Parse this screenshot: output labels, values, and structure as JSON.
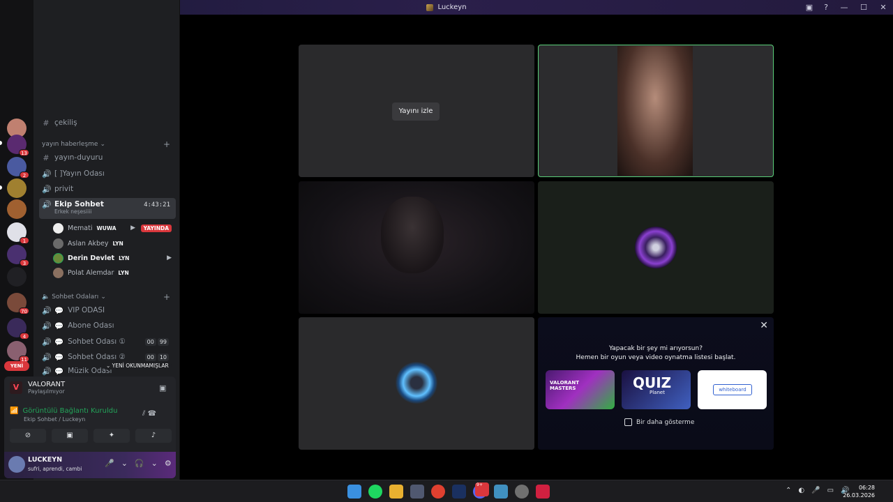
{
  "window": {
    "title": "Luckeyn",
    "controls": [
      "minimize",
      "maximize",
      "close"
    ]
  },
  "server_badges": [
    "13",
    "2",
    "1",
    "3",
    "70",
    "4",
    "11"
  ],
  "new_badge": "YENİ",
  "channels": {
    "partial_top": "çekiliş",
    "category1": {
      "label": "yayın haberleşme"
    },
    "items1": [
      {
        "icon": "#",
        "label": "yayın-duyuru"
      },
      {
        "icon": "speaker",
        "label": "[  ]Yayın Odası"
      },
      {
        "icon": "speaker",
        "label": "privit"
      }
    ],
    "active": {
      "label": "Ekip Sohbet",
      "status": "Erkek neşesiiii",
      "time": "4:43:21"
    },
    "members": [
      {
        "name": "Memati",
        "tag": "WUWA",
        "live": "YAYINDA"
      },
      {
        "name": "Aslan Akbey",
        "tag": "LYN"
      },
      {
        "name": "Derin Devlet",
        "tag": "LYN"
      },
      {
        "name": "Polat Alemdar",
        "tag": "LYN"
      }
    ],
    "category2": {
      "label": "Sohbet Odaları"
    },
    "items2": [
      {
        "label": "VIP ODASI"
      },
      {
        "label": "Abone Odası"
      },
      {
        "label": "Sohbet Odası ①",
        "counts": [
          "00",
          "99"
        ]
      },
      {
        "label": "Sohbet Odası ②",
        "counts": [
          "00",
          "10"
        ]
      },
      {
        "label": "Müzik Odası"
      }
    ],
    "unread_label": "YENİ OKUNMAMIŞLAR"
  },
  "panel": {
    "game_name": "VALORANT",
    "game_status": "Paylaşılmıyor",
    "connection": "Görüntülü Bağlantı Kuruldu",
    "connection_sub": "Ekip Sohbet / Luckeyn",
    "user_name": "LUCKEYN",
    "user_status": "sufri, aprendi, cambi"
  },
  "grid": {
    "watch_button": "Yayını izle",
    "activity_q1": "Yapacak bir şey mi arıyorsun?",
    "activity_q2": "Hemen bir oyun veya video oynatma listesi başlat.",
    "activities": [
      "VALORANT MASTERS",
      "QUIZ",
      "whiteboard"
    ],
    "quiz_sub": "Planet",
    "dont_show": "Bir daha gösterme"
  },
  "taskbar": {
    "time": "06:28",
    "date": "26.03.2026",
    "discord_badge": "9+"
  }
}
